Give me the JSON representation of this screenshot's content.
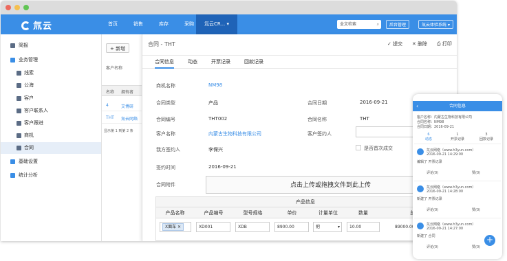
{
  "colors": {
    "brand": "#3a8ee6",
    "nav_active": "#1f63b7",
    "link": "#3a8ee6"
  },
  "logo": {
    "text": "氚云",
    "icon": "brand-c-logo"
  },
  "nav": {
    "items": [
      "首页",
      "销售",
      "库存",
      "采购"
    ],
    "active": "氚云CR...",
    "search_placeholder": "全文检索",
    "admin_btn": "后台管理",
    "user_btn": "氚云体验系统"
  },
  "sidebar": {
    "items": [
      {
        "label": "简报",
        "icon": "briefing-icon"
      },
      {
        "label": "业务管理",
        "icon": "folder-icon"
      },
      {
        "label": "线索",
        "icon": "lead-icon"
      },
      {
        "label": "公海",
        "icon": "pool-icon"
      },
      {
        "label": "客户",
        "icon": "customer-icon"
      },
      {
        "label": "客户联系人",
        "icon": "contact-icon"
      },
      {
        "label": "客户跟进",
        "icon": "followup-icon"
      },
      {
        "label": "商机",
        "icon": "opportunity-icon"
      },
      {
        "label": "合同",
        "icon": "contract-icon"
      },
      {
        "label": "基础设置",
        "icon": "folder-icon"
      },
      {
        "label": "统计分析",
        "icon": "folder-icon"
      }
    ]
  },
  "list": {
    "new_btn": "+ 新增",
    "filter_label": "客户名称",
    "col1": "名称",
    "col2": "拥有者",
    "rows": [
      {
        "name": "4",
        "owner": "艾博研"
      },
      {
        "name": "THT",
        "owner": "氚云网络"
      }
    ],
    "pager": "显示第 1 到第 2 条"
  },
  "detail": {
    "title": "合同 - THT",
    "actions": [
      "✓ 提交",
      "✕ 删除",
      "打印"
    ],
    "tabs": [
      "合同信息",
      "动态",
      "开票记录",
      "回款记录"
    ],
    "fields": {
      "opportunity_label": "商机名称",
      "opportunity_value": "NM98",
      "type_label": "合同类型",
      "type_value": "产品",
      "date_label": "合同日期",
      "date_value": "2016-09-21",
      "code_label": "合同编号",
      "code_value": "THT002",
      "name_label": "合同名称",
      "name_value": "THT",
      "customer_label": "客户名称",
      "customer_value": "内蒙古生物科技有限公司",
      "signer_label": "客户签约人",
      "our_signer_label": "我方签约人",
      "our_signer_value": "李保兴",
      "first_deal_label": "是否首次成交",
      "sign_time_label": "签约时间",
      "sign_time_value": "2016-09-21",
      "attachment_label": "合同附件",
      "upload_text": "点击上传或拖拽文件到此上传"
    },
    "products": {
      "title": "产品信息",
      "headers": [
        "产品名称",
        "产品编号",
        "型号规格",
        "单价",
        "计量单位",
        "数量",
        "总价"
      ],
      "row": {
        "name": "X面车",
        "code": "XD001",
        "model": "XDB",
        "price": "8900.00",
        "unit": "把",
        "qty": "10.00",
        "total": "89000.00"
      }
    }
  },
  "mobile": {
    "title": "合同信息",
    "info": [
      "客户名称：内蒙古生物科技有限公司",
      "合同名称：NM98",
      "合同日期：2016-09-21"
    ],
    "tabs": [
      {
        "count": "6",
        "label": "动态"
      },
      {
        "count": "1",
        "label": "开票记录"
      },
      {
        "count": "3",
        "label": "回款记录"
      }
    ],
    "cards": [
      {
        "name": "氚云网络（www.h3yun.com）",
        "time": "2016-09-21 14:29:00",
        "text": "编辑了 开票记录",
        "like": "评论(0)",
        "reply": "赞(0)"
      },
      {
        "name": "氚云网络（www.h3yun.com）",
        "time": "2016-09-21 14:28:00",
        "text": "新建了 开票记录",
        "like": "评论(0)",
        "reply": "赞(0)"
      },
      {
        "name": "氚云网络（www.h3yun.com）",
        "time": "2016-09-21 14:27:00",
        "text": "新建了 合同",
        "like": "评论(0)",
        "reply": "赞(0)"
      }
    ],
    "fab": "+"
  }
}
